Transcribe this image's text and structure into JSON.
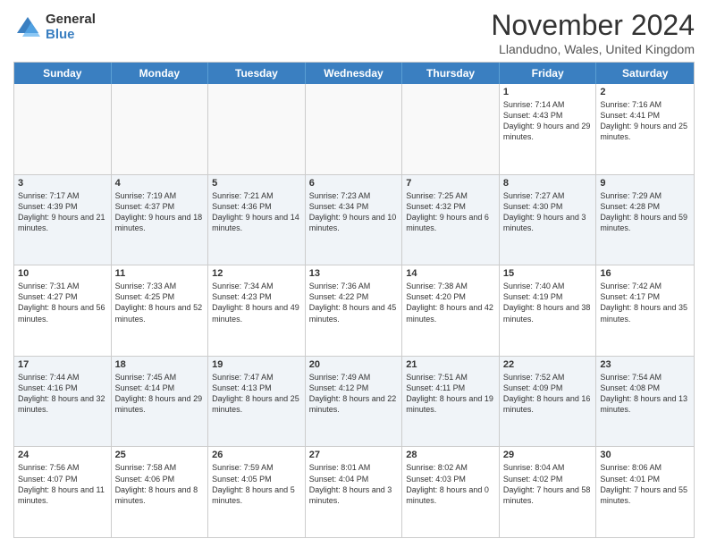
{
  "logo": {
    "general": "General",
    "blue": "Blue"
  },
  "title": "November 2024",
  "subtitle": "Llandudno, Wales, United Kingdom",
  "days": [
    "Sunday",
    "Monday",
    "Tuesday",
    "Wednesday",
    "Thursday",
    "Friday",
    "Saturday"
  ],
  "rows": [
    [
      {
        "day": "",
        "text": ""
      },
      {
        "day": "",
        "text": ""
      },
      {
        "day": "",
        "text": ""
      },
      {
        "day": "",
        "text": ""
      },
      {
        "day": "",
        "text": ""
      },
      {
        "day": "1",
        "text": "Sunrise: 7:14 AM\nSunset: 4:43 PM\nDaylight: 9 hours and 29 minutes."
      },
      {
        "day": "2",
        "text": "Sunrise: 7:16 AM\nSunset: 4:41 PM\nDaylight: 9 hours and 25 minutes."
      }
    ],
    [
      {
        "day": "3",
        "text": "Sunrise: 7:17 AM\nSunset: 4:39 PM\nDaylight: 9 hours and 21 minutes."
      },
      {
        "day": "4",
        "text": "Sunrise: 7:19 AM\nSunset: 4:37 PM\nDaylight: 9 hours and 18 minutes."
      },
      {
        "day": "5",
        "text": "Sunrise: 7:21 AM\nSunset: 4:36 PM\nDaylight: 9 hours and 14 minutes."
      },
      {
        "day": "6",
        "text": "Sunrise: 7:23 AM\nSunset: 4:34 PM\nDaylight: 9 hours and 10 minutes."
      },
      {
        "day": "7",
        "text": "Sunrise: 7:25 AM\nSunset: 4:32 PM\nDaylight: 9 hours and 6 minutes."
      },
      {
        "day": "8",
        "text": "Sunrise: 7:27 AM\nSunset: 4:30 PM\nDaylight: 9 hours and 3 minutes."
      },
      {
        "day": "9",
        "text": "Sunrise: 7:29 AM\nSunset: 4:28 PM\nDaylight: 8 hours and 59 minutes."
      }
    ],
    [
      {
        "day": "10",
        "text": "Sunrise: 7:31 AM\nSunset: 4:27 PM\nDaylight: 8 hours and 56 minutes."
      },
      {
        "day": "11",
        "text": "Sunrise: 7:33 AM\nSunset: 4:25 PM\nDaylight: 8 hours and 52 minutes."
      },
      {
        "day": "12",
        "text": "Sunrise: 7:34 AM\nSunset: 4:23 PM\nDaylight: 8 hours and 49 minutes."
      },
      {
        "day": "13",
        "text": "Sunrise: 7:36 AM\nSunset: 4:22 PM\nDaylight: 8 hours and 45 minutes."
      },
      {
        "day": "14",
        "text": "Sunrise: 7:38 AM\nSunset: 4:20 PM\nDaylight: 8 hours and 42 minutes."
      },
      {
        "day": "15",
        "text": "Sunrise: 7:40 AM\nSunset: 4:19 PM\nDaylight: 8 hours and 38 minutes."
      },
      {
        "day": "16",
        "text": "Sunrise: 7:42 AM\nSunset: 4:17 PM\nDaylight: 8 hours and 35 minutes."
      }
    ],
    [
      {
        "day": "17",
        "text": "Sunrise: 7:44 AM\nSunset: 4:16 PM\nDaylight: 8 hours and 32 minutes."
      },
      {
        "day": "18",
        "text": "Sunrise: 7:45 AM\nSunset: 4:14 PM\nDaylight: 8 hours and 29 minutes."
      },
      {
        "day": "19",
        "text": "Sunrise: 7:47 AM\nSunset: 4:13 PM\nDaylight: 8 hours and 25 minutes."
      },
      {
        "day": "20",
        "text": "Sunrise: 7:49 AM\nSunset: 4:12 PM\nDaylight: 8 hours and 22 minutes."
      },
      {
        "day": "21",
        "text": "Sunrise: 7:51 AM\nSunset: 4:11 PM\nDaylight: 8 hours and 19 minutes."
      },
      {
        "day": "22",
        "text": "Sunrise: 7:52 AM\nSunset: 4:09 PM\nDaylight: 8 hours and 16 minutes."
      },
      {
        "day": "23",
        "text": "Sunrise: 7:54 AM\nSunset: 4:08 PM\nDaylight: 8 hours and 13 minutes."
      }
    ],
    [
      {
        "day": "24",
        "text": "Sunrise: 7:56 AM\nSunset: 4:07 PM\nDaylight: 8 hours and 11 minutes."
      },
      {
        "day": "25",
        "text": "Sunrise: 7:58 AM\nSunset: 4:06 PM\nDaylight: 8 hours and 8 minutes."
      },
      {
        "day": "26",
        "text": "Sunrise: 7:59 AM\nSunset: 4:05 PM\nDaylight: 8 hours and 5 minutes."
      },
      {
        "day": "27",
        "text": "Sunrise: 8:01 AM\nSunset: 4:04 PM\nDaylight: 8 hours and 3 minutes."
      },
      {
        "day": "28",
        "text": "Sunrise: 8:02 AM\nSunset: 4:03 PM\nDaylight: 8 hours and 0 minutes."
      },
      {
        "day": "29",
        "text": "Sunrise: 8:04 AM\nSunset: 4:02 PM\nDaylight: 7 hours and 58 minutes."
      },
      {
        "day": "30",
        "text": "Sunrise: 8:06 AM\nSunset: 4:01 PM\nDaylight: 7 hours and 55 minutes."
      }
    ]
  ]
}
